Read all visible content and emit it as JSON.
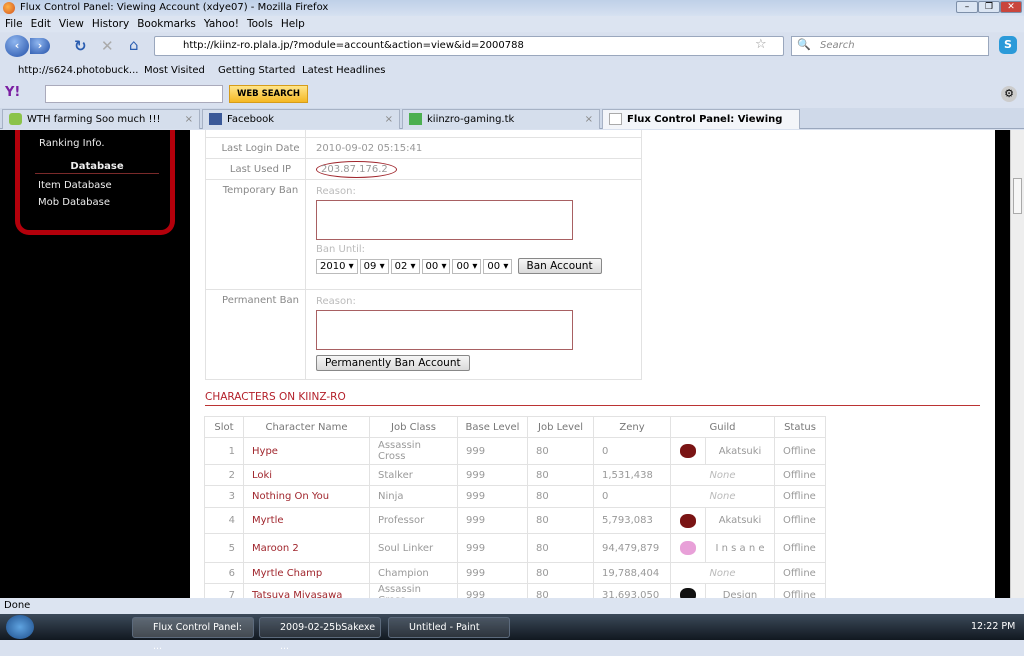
{
  "window": {
    "title": "Flux Control Panel: Viewing Account (xdye07) - Mozilla Firefox"
  },
  "menu": [
    "File",
    "Edit",
    "View",
    "History",
    "Bookmarks",
    "Yahoo!",
    "Tools",
    "Help"
  ],
  "nav": {
    "url": "http://kiinz-ro.plala.jp/?module=account&action=view&id=2000788",
    "search_placeholder": "Search"
  },
  "bookmarks": [
    "http://s624.photobuck...",
    "Most Visited",
    "Getting Started",
    "Latest Headlines"
  ],
  "yahoo": {
    "web_search": "WEB SEARCH"
  },
  "tabs": [
    {
      "label": "WTH farming Soo much !!!"
    },
    {
      "label": "Facebook"
    },
    {
      "label": "kiinzro-gaming.tk"
    },
    {
      "label": "Flux Control Panel: Viewing Acco..."
    }
  ],
  "sidebar": {
    "ranking": "Ranking Info.",
    "db_header": "Database",
    "items": [
      "Item Database",
      "Mob Database"
    ]
  },
  "account": {
    "last_login_label": "Last Login Date",
    "last_login": "2010-09-02 05:15:41",
    "last_ip_label": "Last Used IP",
    "last_ip": "203.87.176.2",
    "temp_ban_label": "Temporary Ban",
    "reason_label": "Reason:",
    "ban_until_label": "Ban Until:",
    "ban_until": {
      "year": "2010",
      "month": "09",
      "day": "02",
      "hour": "00",
      "minute": "00",
      "second": "00"
    },
    "ban_button": "Ban Account",
    "perm_ban_label": "Permanent Ban",
    "perm_ban_button": "Permanently Ban Account"
  },
  "characters": {
    "heading": "CHARACTERS ON KIINZ-RO",
    "columns": [
      "Slot",
      "Character Name",
      "Job Class",
      "Base Level",
      "Job Level",
      "Zeny",
      "Guild",
      "Status"
    ],
    "rows": [
      {
        "slot": "1",
        "name": "Hype",
        "job": "Assassin Cross",
        "base": "999",
        "joblv": "80",
        "zeny": "0",
        "guild": "Akatsuki",
        "status": "Offline"
      },
      {
        "slot": "2",
        "name": "Loki",
        "job": "Stalker",
        "base": "999",
        "joblv": "80",
        "zeny": "1,531,438",
        "guild": "None",
        "status": "Offline"
      },
      {
        "slot": "3",
        "name": "Nothing On You",
        "job": "Ninja",
        "base": "999",
        "joblv": "80",
        "zeny": "0",
        "guild": "None",
        "status": "Offline"
      },
      {
        "slot": "4",
        "name": "Myrtle",
        "job": "Professor",
        "base": "999",
        "joblv": "80",
        "zeny": "5,793,083",
        "guild": "Akatsuki",
        "status": "Offline"
      },
      {
        "slot": "5",
        "name": "Maroon 2",
        "job": "Soul Linker",
        "base": "999",
        "joblv": "80",
        "zeny": "94,479,879",
        "guild": "I n s a n e",
        "status": "Offline"
      },
      {
        "slot": "6",
        "name": "Myrtle Champ",
        "job": "Champion",
        "base": "999",
        "joblv": "80",
        "zeny": "19,788,404",
        "guild": "None",
        "status": "Offline"
      },
      {
        "slot": "7",
        "name": "Tatsuya Miyasawa",
        "job": "Assassin Cross",
        "base": "999",
        "joblv": "80",
        "zeny": "31,693,050",
        "guild": "Design",
        "status": "Offline"
      }
    ]
  },
  "statusbar": "Done",
  "taskbar": {
    "items": [
      "Flux Control Panel: ...",
      "2009-02-25bSakexe ...",
      "Untitled - Paint"
    ],
    "clock": "12:22 PM"
  }
}
